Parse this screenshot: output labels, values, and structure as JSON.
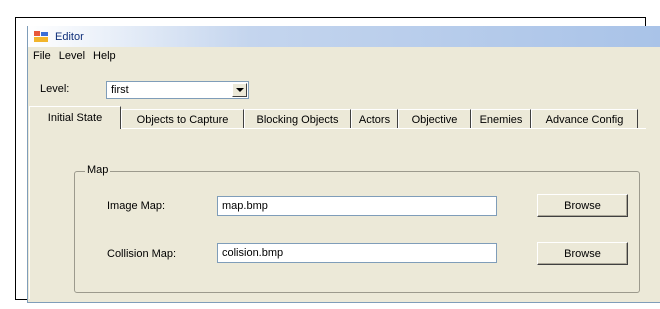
{
  "window": {
    "title": "Editor"
  },
  "menu": {
    "items": [
      "File",
      "Level",
      "Help"
    ]
  },
  "level": {
    "label": "Level:",
    "selected": "first"
  },
  "tabs": [
    {
      "label": "Initial State",
      "active": true
    },
    {
      "label": "Objects to Capture"
    },
    {
      "label": "Blocking Objects"
    },
    {
      "label": "Actors"
    },
    {
      "label": "Objective"
    },
    {
      "label": "Enemies"
    },
    {
      "label": "Advance Config"
    }
  ],
  "map_group": {
    "title": "Map",
    "image_map": {
      "label": "Image Map:",
      "value": "map.bmp",
      "button": "Browse"
    },
    "collision_map": {
      "label": "Collision Map:",
      "value": "colision.bmp",
      "button": "Browse"
    }
  }
}
